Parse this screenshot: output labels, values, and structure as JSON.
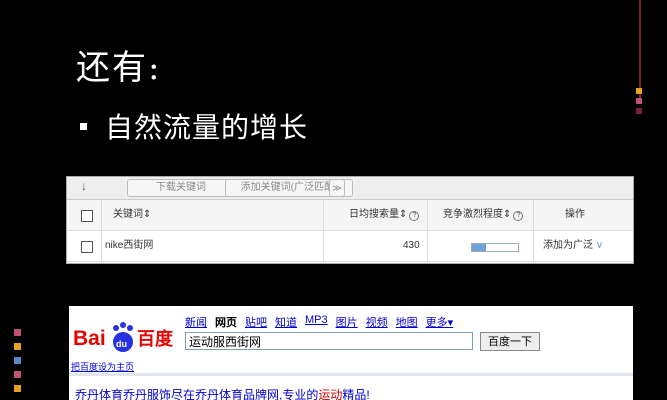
{
  "slide": {
    "title": "还有:",
    "bullet": "自然流量的增长"
  },
  "keyword_tool": {
    "toolbar": {
      "arrow": "↓",
      "download_label": "下载关键词",
      "add_label": "添加关键词(广泛匹配)",
      "chevron": "≫"
    },
    "columns": {
      "keyword": "关键词",
      "daily_searches": "日均搜索量",
      "competition": "竞争激烈程度",
      "action": "操作"
    },
    "row": {
      "keyword": "nike西街网",
      "daily_searches": "430",
      "competition_level": 0.3,
      "action": "添加为广泛"
    }
  },
  "baidu": {
    "logo_text": "Baidu百度",
    "nav": [
      "新闻",
      "网页",
      "贴吧",
      "知道",
      "MP3",
      "图片",
      "视频",
      "地图",
      "更多▾"
    ],
    "search_value": "运动服西街网",
    "search_button": "百度一下",
    "set_home": "把百度设为主页",
    "result_prefix": "乔丹体育乔丹服饰尽在乔丹体育品牌网,专业的",
    "result_highlight": "运动",
    "result_suffix": "精品!"
  },
  "colors": {
    "accent_dark": "#7a1f3a",
    "deco_orange": "#e8a020",
    "deco_pink": "#c0507a",
    "deco_blue": "#5c8ac8",
    "baidu_red": "#e10602",
    "baidu_blue": "#2932e1"
  }
}
